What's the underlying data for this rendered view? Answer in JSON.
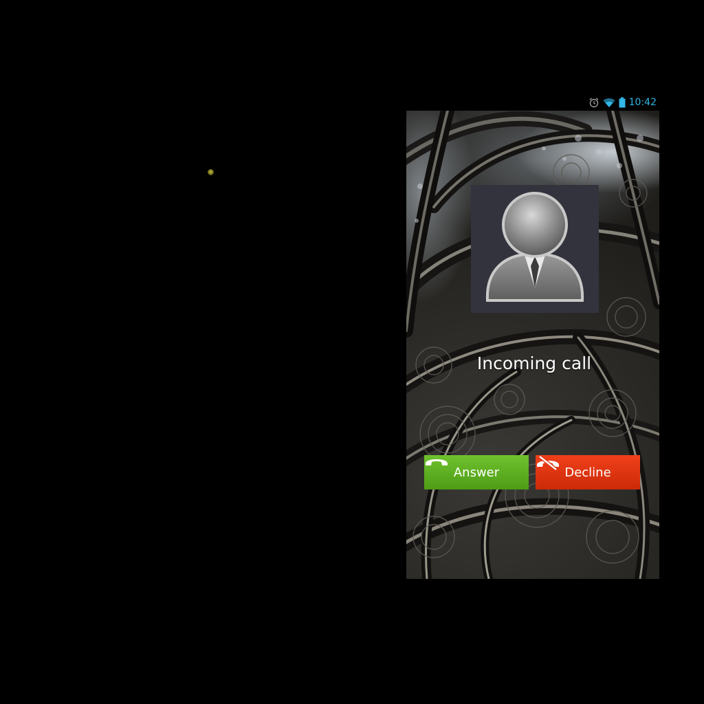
{
  "status_bar": {
    "time": "10:42",
    "icons": [
      "alarm-icon",
      "wifi-icon",
      "battery-icon"
    ],
    "accent_color": "#33b5e5"
  },
  "call": {
    "status_label": "Incoming call",
    "avatar_icon": "person-silhouette-icon"
  },
  "actions": {
    "answer_label": "Answer",
    "answer_icon": "phone-handset-icon",
    "answer_color": "#5bb021",
    "decline_label": "Decline",
    "decline_icon": "phone-hangup-icon",
    "decline_color": "#e33510"
  }
}
